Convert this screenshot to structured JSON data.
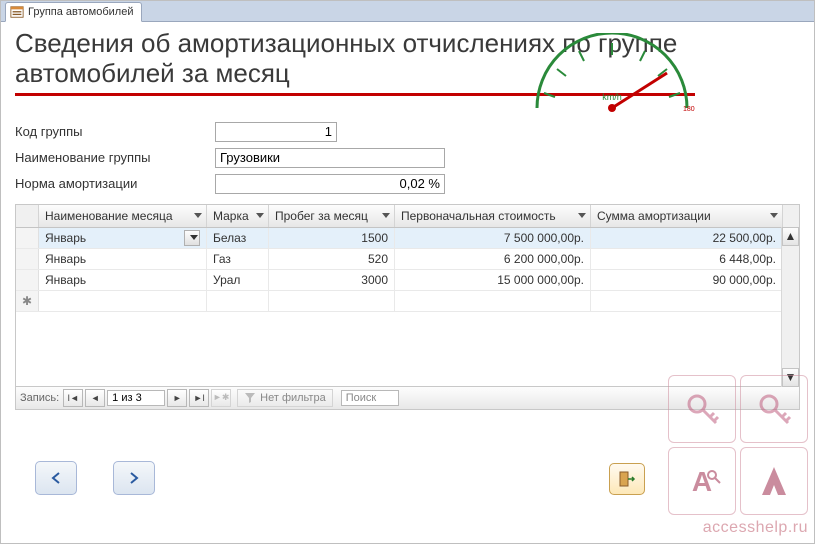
{
  "tab": {
    "label": "Группа автомобилей"
  },
  "title": "Сведения об амортизационных отчислениях по группе автомобилей за месяц",
  "gauge": {
    "unit": "km/h"
  },
  "form": {
    "code_label": "Код группы",
    "code_value": "1",
    "name_label": "Наименование группы",
    "name_value": "Грузовики",
    "rate_label": "Норма амортизации",
    "rate_value": "0,02 %"
  },
  "grid": {
    "columns": {
      "month": "Наименование месяца",
      "brand": "Марка",
      "mileage": "Пробег за месяц",
      "cost": "Первоначальная стоимость",
      "deprec": "Сумма амортизации"
    },
    "rows": [
      {
        "month": "Январь",
        "brand": "Белаз",
        "mileage": "1500",
        "cost": "7 500 000,00р.",
        "deprec": "22 500,00р."
      },
      {
        "month": "Январь",
        "brand": "Газ",
        "mileage": "520",
        "cost": "6 200 000,00р.",
        "deprec": "6 448,00р."
      },
      {
        "month": "Январь",
        "brand": "Урал",
        "mileage": "3000",
        "cost": "15 000 000,00р.",
        "deprec": "90 000,00р."
      }
    ]
  },
  "recnav": {
    "label": "Запись:",
    "position": "1 из 3",
    "no_filter": "Нет фильтра",
    "search": "Поиск"
  },
  "watermark": {
    "site": "accesshelp.ru"
  }
}
